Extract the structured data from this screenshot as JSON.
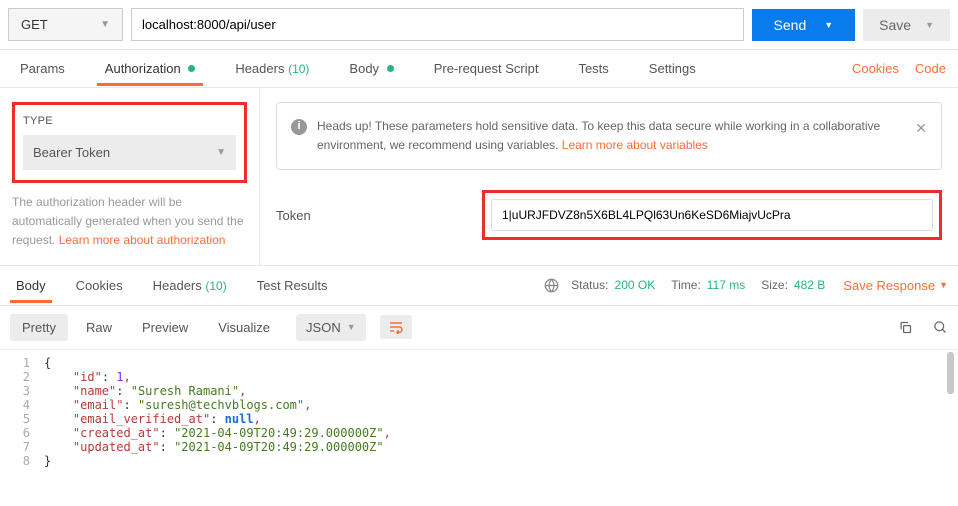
{
  "request": {
    "method": "GET",
    "url": "localhost:8000/api/user",
    "send_label": "Send",
    "save_label": "Save"
  },
  "tabs": {
    "params": "Params",
    "authorization": "Authorization",
    "headers": "Headers",
    "headers_count": "(10)",
    "body": "Body",
    "prerequest": "Pre-request Script",
    "tests": "Tests",
    "settings": "Settings",
    "cookies": "Cookies",
    "code": "Code"
  },
  "auth": {
    "type_label": "TYPE",
    "type_value": "Bearer Token",
    "help_text": "The authorization header will be automatically generated when you send the request. ",
    "help_link": "Learn more about authorization",
    "banner_text": "Heads up! These parameters hold sensitive data. To keep this data secure while working in a collaborative environment, we recommend using variables. ",
    "banner_link": "Learn more about variables",
    "token_label": "Token",
    "token_value": "1|uURJFDVZ8n5X6BL4LPQl63Un6KeSD6MiajvUcPra"
  },
  "response": {
    "tabs": {
      "body": "Body",
      "cookies": "Cookies",
      "headers": "Headers",
      "headers_count": "(10)",
      "testresults": "Test Results"
    },
    "status_label": "Status:",
    "status_value": "200 OK",
    "time_label": "Time:",
    "time_value": "117 ms",
    "size_label": "Size:",
    "size_value": "482 B",
    "save_response": "Save Response",
    "view": {
      "pretty": "Pretty",
      "raw": "Raw",
      "preview": "Preview",
      "visualize": "Visualize",
      "format": "JSON"
    },
    "json": {
      "id": 1,
      "name": "Suresh Ramani",
      "email": "suresh@techvblogs.com",
      "email_verified_at": null,
      "created_at": "2021-04-09T20:49:29.000000Z",
      "updated_at": "2021-04-09T20:49:29.000000Z"
    }
  }
}
